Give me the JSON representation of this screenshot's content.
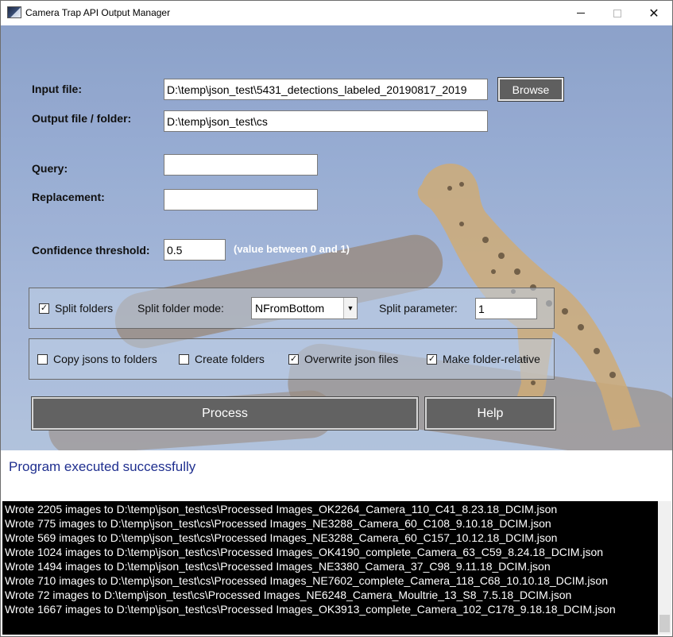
{
  "window": {
    "title": "Camera Trap API Output Manager",
    "controls": {
      "minimize": "—",
      "maximize": "□",
      "close": "✕"
    }
  },
  "form": {
    "input_file": {
      "label": "Input file:",
      "value": "D:\\temp\\json_test\\5431_detections_labeled_20190817_2019"
    },
    "output_file": {
      "label": "Output file / folder:",
      "value": "D:\\temp\\json_test\\cs"
    },
    "browse_label": "Browse",
    "query": {
      "label": "Query:",
      "value": ""
    },
    "replacement": {
      "label": "Replacement:",
      "value": ""
    },
    "confidence": {
      "label": "Confidence threshold:",
      "value": "0.5",
      "hint": "(value between 0 and 1)"
    }
  },
  "split_group": {
    "split_folders": {
      "label": "Split folders",
      "checked": true
    },
    "mode_label": "Split folder mode:",
    "mode_value": "NFromBottom",
    "param_label": "Split parameter:",
    "param_value": "1"
  },
  "options_group": {
    "copy_jsons": {
      "label": "Copy jsons to folders",
      "checked": false
    },
    "create_folders": {
      "label": "Create folders",
      "checked": false
    },
    "overwrite": {
      "label": "Overwrite json files",
      "checked": true
    },
    "folder_relative": {
      "label": "Make folder-relative",
      "checked": true
    }
  },
  "buttons": {
    "process": "Process",
    "help": "Help"
  },
  "status": "Program executed successfully",
  "log": [
    "Wrote 2205 images to D:\\temp\\json_test\\cs\\Processed Images_OK2264_Camera_110_C41_8.23.18_DCIM.json",
    "Wrote 775 images to D:\\temp\\json_test\\cs\\Processed Images_NE3288_Camera_60_C108_9.10.18_DCIM.json",
    "Wrote 569 images to D:\\temp\\json_test\\cs\\Processed Images_NE3288_Camera_60_C157_10.12.18_DCIM.json",
    "Wrote 1024 images to D:\\temp\\json_test\\cs\\Processed Images_OK4190_complete_Camera_63_C59_8.24.18_DCIM.json",
    "Wrote 1494 images to D:\\temp\\json_test\\cs\\Processed Images_NE3380_Camera_37_C98_9.11.18_DCIM.json",
    "Wrote 710 images to D:\\temp\\json_test\\cs\\Processed Images_NE7602_complete_Camera_118_C68_10.10.18_DCIM.json",
    "Wrote 72 images to D:\\temp\\json_test\\cs\\Processed Images_NE6248_Camera_Moultrie_13_S8_7.5.18_DCIM.json",
    "Wrote 1667 images to D:\\temp\\json_test\\cs\\Processed Images_OK3913_complete_Camera_102_C178_9.18.18_DCIM.json"
  ],
  "colors": {
    "status": "#1f2f8f",
    "button": "#626262",
    "console_bg": "#000000"
  }
}
